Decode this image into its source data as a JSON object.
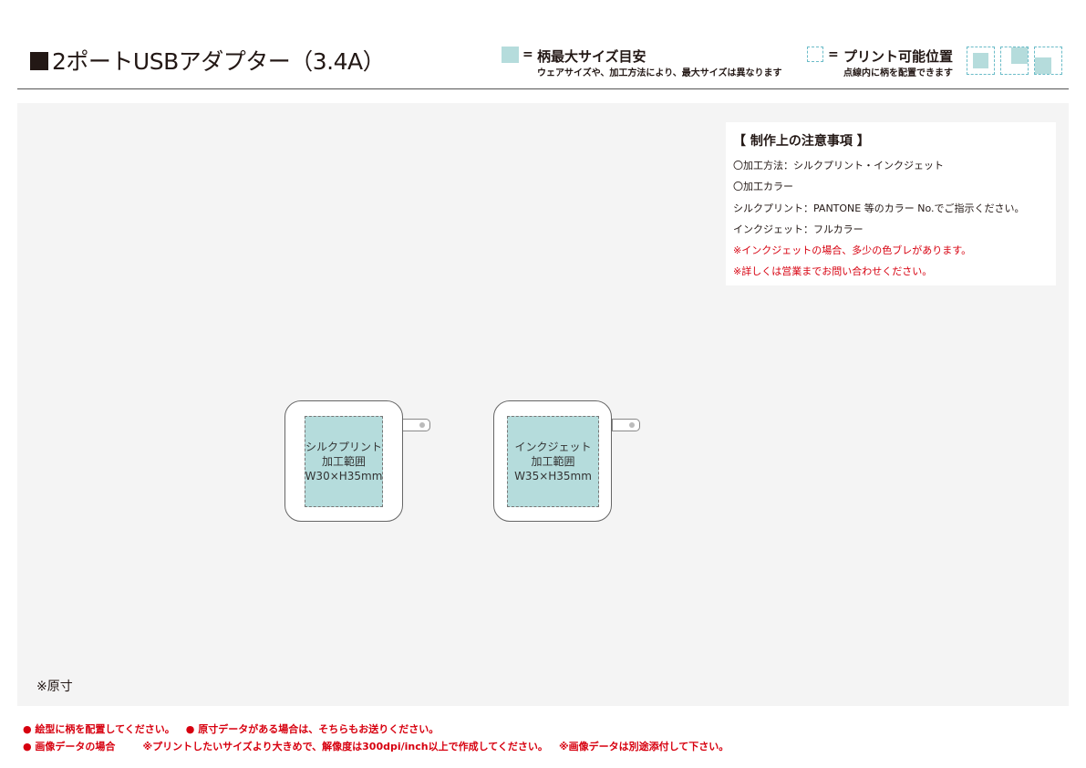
{
  "header": {
    "title": "2ポートUSBアダプター（3.4A）",
    "legend_fill": {
      "eq": "=",
      "title": "柄最大サイズ目安",
      "subtitle": "ウェアサイズや、加工方法により、最大サイズは異なります"
    },
    "legend_print": {
      "eq": "=",
      "title": "プリント可能位置",
      "subtitle": "点線内に柄を配置できます"
    }
  },
  "notes": {
    "title": "【 制作上の注意事項 】",
    "lines": [
      "〇加工方法：シルクプリント・インクジェット",
      "〇加工カラー",
      "シルクプリント：PANTONE 等のカラー No.でご指示ください。",
      "インクジェット：フルカラー"
    ],
    "warnings": [
      "※インクジェットの場合、多少の色ブレがあります。",
      "※詳しくは営業までお問い合わせください。"
    ]
  },
  "templates": [
    {
      "method": "シルクプリント",
      "label": "加工範囲",
      "size": "W30×H35mm"
    },
    {
      "method": "インクジェット",
      "label": "加工範囲",
      "size": "W35×H35mm"
    }
  ],
  "actual_size_note": "※原寸",
  "footer": {
    "line1": [
      "● 絵型に柄を配置してください。",
      "● 原寸データがある場合は、そちらもお送りください。"
    ],
    "line2": [
      "● 画像データの場合",
      "※プリントしたいサイズより大きめで、解像度は300dpi/inch以上で作成してください。",
      "※画像データは別途添付して下さい。"
    ]
  },
  "colors": {
    "accent_fill": "#b5dcdc",
    "dash_line": "#6bbcc8",
    "warning": "#d7000f"
  }
}
